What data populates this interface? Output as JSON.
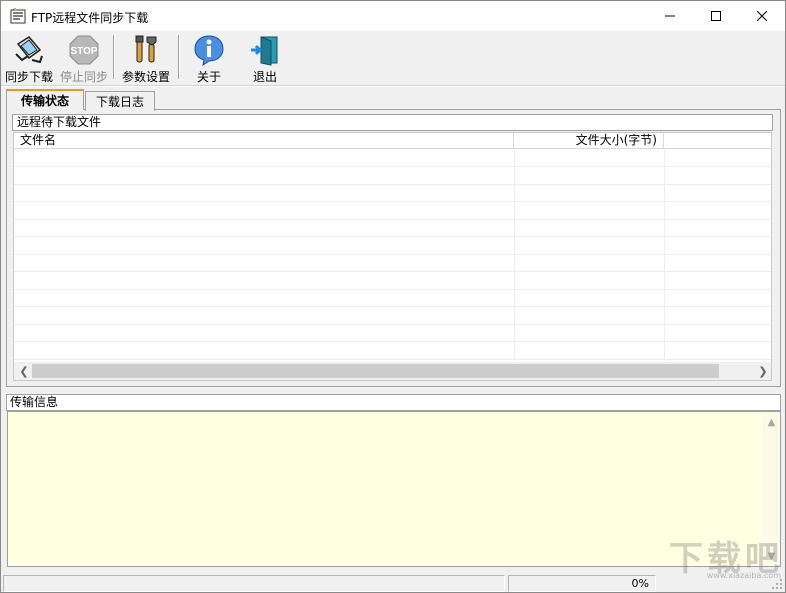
{
  "window": {
    "title": "FTP远程文件同步下载"
  },
  "toolbar": {
    "items": [
      {
        "label": "同步下载",
        "icon": "sync-download-icon",
        "enabled": true
      },
      {
        "label": "停止同步",
        "icon": "stop-sign-icon",
        "enabled": false
      },
      {
        "label": "参数设置",
        "icon": "tools-icon",
        "enabled": true
      },
      {
        "label": "关于",
        "icon": "info-icon",
        "enabled": true
      },
      {
        "label": "退出",
        "icon": "exit-door-icon",
        "enabled": true
      }
    ]
  },
  "tabs": [
    {
      "label": "传输状态",
      "active": true
    },
    {
      "label": "下载日志",
      "active": false
    }
  ],
  "remote": {
    "caption": "远程待下载文件",
    "columns": [
      "文件名",
      "文件大小(字节)"
    ],
    "rows": []
  },
  "transfer": {
    "caption": "传输信息",
    "content": ""
  },
  "statusbar": {
    "message": "",
    "progress": "0%"
  },
  "watermark": {
    "main": "下载吧",
    "sub": "www.xiazaiba.com"
  },
  "colors": {
    "active_tab_accent": "#e09a2f",
    "info_background": "#ffffe1"
  }
}
